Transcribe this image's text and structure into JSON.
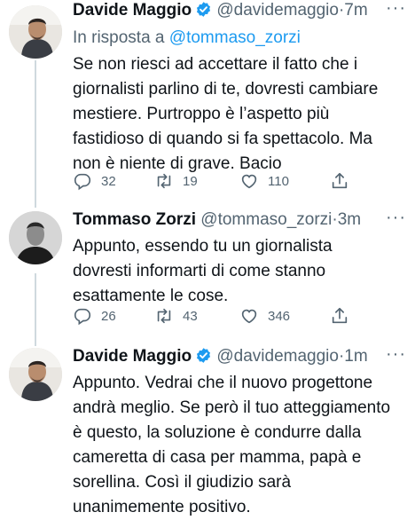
{
  "tweets": [
    {
      "author_name": "Davide Maggio",
      "verified": true,
      "handle": "@davidemaggio",
      "separator": "·",
      "time": "7m",
      "more": "···",
      "reply_prefix": "In risposta a",
      "reply_mention": "@tommaso_zorzi",
      "text_lines": [
        "Se non riesci ad accettare il fatto che i",
        "giornalisti parlino di te, dovresti cambiare",
        "mestiere. Purtroppo è l’aspetto più",
        "fastidioso di quando si fa spettacolo. Ma",
        "non è niente di grave. Bacio"
      ],
      "replies": "32",
      "retweets": "19",
      "likes": "110"
    },
    {
      "author_name": "Tommaso Zorzi",
      "verified": false,
      "handle": "@tommaso_zorzi",
      "separator": "·",
      "time": "3m",
      "more": "···",
      "text_lines": [
        "Appunto, essendo tu un giornalista",
        "dovresti informarti di come stanno",
        "esattamente le cose."
      ],
      "replies": "26",
      "retweets": "43",
      "likes": "346"
    },
    {
      "author_name": "Davide Maggio",
      "verified": true,
      "handle": "@davidemaggio",
      "separator": "·",
      "time": "1m",
      "more": "···",
      "text_lines": [
        "Appunto. Vedrai che il nuovo progettone",
        "andrà meglio. Se però il tuo atteggiamento",
        "è questo, la soluzione è condurre dalla",
        "cameretta di casa per mamma, papà e",
        "sorellina. Così il giudizio sarà",
        "unanimemente positivo."
      ]
    }
  ],
  "colors": {
    "text": "#0f1419",
    "secondary": "#536471",
    "link": "#1d9bf0",
    "verified": "#1d9bf0",
    "thread_line": "#cfd9de"
  },
  "icons": [
    "reply-icon",
    "retweet-icon",
    "like-icon",
    "share-icon",
    "verified-badge-icon",
    "more-options-icon"
  ]
}
